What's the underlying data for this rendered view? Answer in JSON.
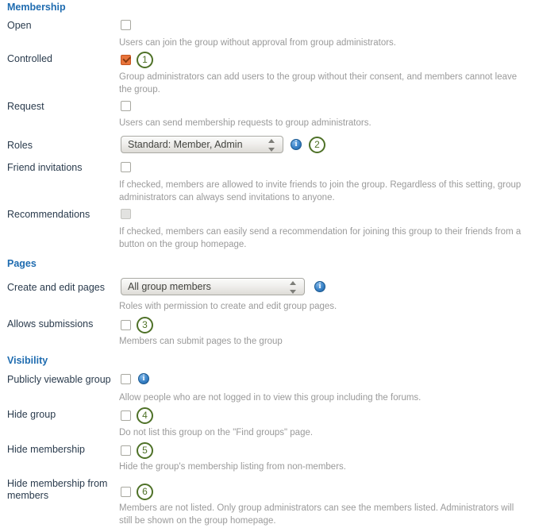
{
  "page": {
    "title": "Group settings form"
  },
  "colors": {
    "section_heading": "#1f6cb0",
    "label": "#2a3b4d",
    "description": "#9a9a9a",
    "checkbox_checked": "#e8743b",
    "annotation_ring": "#4e7127",
    "info_icon": "#3a83c8"
  },
  "sections": [
    {
      "id": "membership",
      "heading": "Membership",
      "rows": [
        {
          "label": "Open",
          "control": "checkbox",
          "checked": false,
          "disabled": false,
          "annotation": null,
          "info": false,
          "description": "Users can join the group without approval from group administrators."
        },
        {
          "label": "Controlled",
          "control": "checkbox",
          "checked": true,
          "disabled": false,
          "annotation": "1",
          "info": false,
          "description": "Group administrators can add users to the group without their consent, and members cannot leave the group."
        },
        {
          "label": "Request",
          "control": "checkbox",
          "checked": false,
          "disabled": false,
          "annotation": null,
          "info": false,
          "description": "Users can send membership requests to group administrators."
        },
        {
          "label": "Roles",
          "control": "select",
          "value": "Standard: Member, Admin",
          "annotation": "2",
          "info": true,
          "description": ""
        },
        {
          "label": "Friend invitations",
          "control": "checkbox",
          "checked": false,
          "disabled": false,
          "annotation": null,
          "info": false,
          "description": "If checked, members are allowed to invite friends to join the group. Regardless of this setting, group administrators can always send invitations to anyone."
        },
        {
          "label": "Recommendations",
          "control": "checkbox",
          "checked": false,
          "disabled": true,
          "annotation": null,
          "info": false,
          "description": "If checked, members can easily send a recommendation for joining this group to their friends from a button on the group homepage."
        }
      ]
    },
    {
      "id": "pages",
      "heading": "Pages",
      "rows": [
        {
          "label": "Create and edit pages",
          "control": "select",
          "value": "All group members",
          "annotation": null,
          "info": true,
          "description": "Roles with permission to create and edit group pages."
        },
        {
          "label": "Allows submissions",
          "control": "checkbox",
          "checked": false,
          "disabled": false,
          "annotation": "3",
          "info": false,
          "description": "Members can submit pages to the group"
        }
      ]
    },
    {
      "id": "visibility",
      "heading": "Visibility",
      "rows": [
        {
          "label": "Publicly viewable group",
          "control": "checkbox",
          "checked": false,
          "disabled": false,
          "annotation": null,
          "info": true,
          "description": "Allow people who are not logged in to view this group including the forums."
        },
        {
          "label": "Hide group",
          "control": "checkbox",
          "checked": false,
          "disabled": false,
          "annotation": "4",
          "info": false,
          "description": "Do not list this group on the \"Find groups\" page."
        },
        {
          "label": "Hide membership",
          "control": "checkbox",
          "checked": false,
          "disabled": false,
          "annotation": "5",
          "info": false,
          "description": "Hide the group's membership listing from non-members."
        },
        {
          "label": "Hide membership from members",
          "control": "checkbox",
          "checked": false,
          "disabled": false,
          "annotation": "6",
          "info": false,
          "description": "Members are not listed. Only group administrators can see the members listed. Administrators will still be shown on the group homepage."
        }
      ]
    }
  ]
}
